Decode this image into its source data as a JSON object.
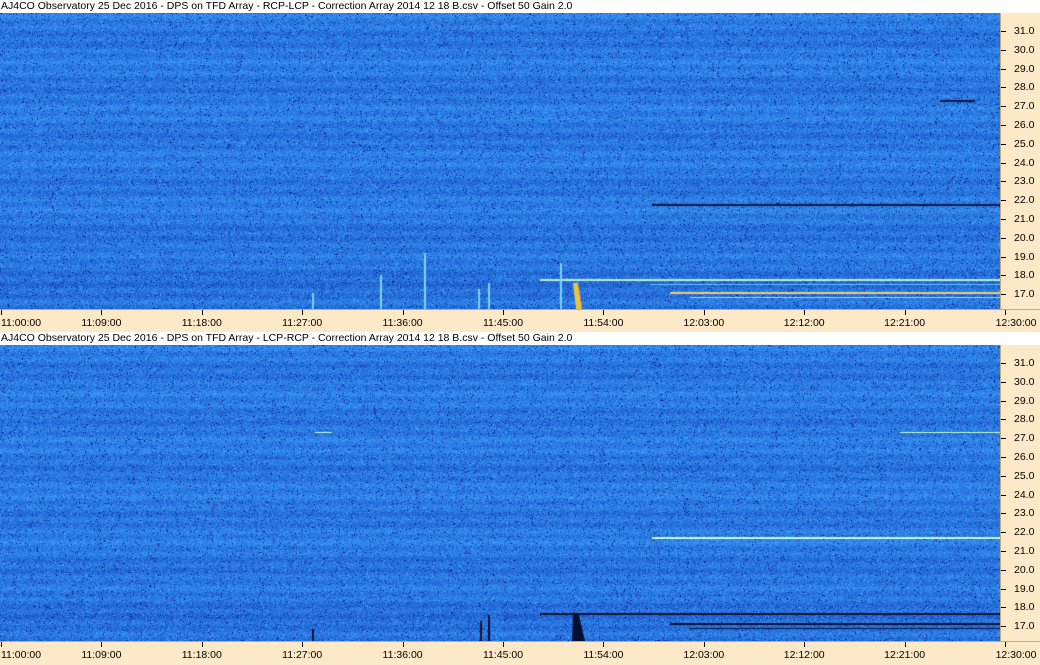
{
  "panels": [
    {
      "title": "AJ4CO Observatory 25 Dec 2016  -  DPS on TFD Array  -  RCP-LCP  -  Correction Array 2014 12 18 B.csv  -  Offset 50  Gain 2.0"
    },
    {
      "title": "AJ4CO Observatory 25 Dec 2016  -  DPS on TFD Array  -  LCP-RCP  -  Correction Array 2014 12 18 B.csv  -  Offset 50  Gain 2.0"
    }
  ],
  "frequency_labels": [
    "31.0",
    "30.0",
    "29.0",
    "28.0",
    "27.0",
    "26.0",
    "25.0",
    "24.0",
    "23.0",
    "22.0",
    "21.0",
    "20.0",
    "19.0",
    "18.0",
    "17.0"
  ],
  "time_labels": [
    "11:00:00",
    "11:09:00",
    "11:18:00",
    "11:27:00",
    "11:36:00",
    "11:45:00",
    "11:54:00",
    "12:03:00",
    "12:12:00",
    "12:21:00",
    "12:30:00"
  ],
  "colors": {
    "spectrogram_base": "#2f6fe0",
    "ruler_background": "#fde8c8"
  }
}
